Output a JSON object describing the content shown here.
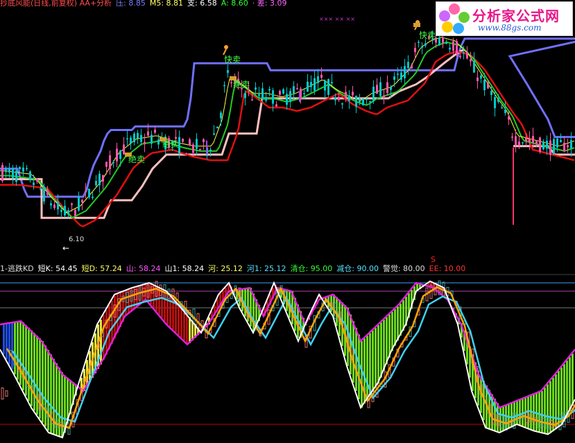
{
  "header": {
    "items": [
      {
        "text": "抄底风能(日线,前复权) AA+分析",
        "color": "#ff4d4d"
      },
      {
        "text": "压: 8.85",
        "color": "#7b7bff"
      },
      {
        "text": "M5: 8.81",
        "color": "#ffff66"
      },
      {
        "text": "支: 6.58",
        "color": "#ffffff"
      },
      {
        "text": "A: 8.60",
        "color": "#33ff33"
      },
      {
        "text": "· 差: 3.09",
        "color": "#ff66ff"
      }
    ]
  },
  "sub_header": {
    "items": [
      {
        "text": "1-逃跌KD",
        "color": "#dddddd"
      },
      {
        "text": "短K: 54.45",
        "color": "#ffffff"
      },
      {
        "text": "短D: 57.24",
        "color": "#ffff66"
      },
      {
        "text": "山: 58.24",
        "color": "#ff55ff"
      },
      {
        "text": "山1: 58.24",
        "color": "#ffffff"
      },
      {
        "text": "河: 25.12",
        "color": "#ffff66"
      },
      {
        "text": "河1: 25.12",
        "color": "#55e0ff"
      },
      {
        "text": "清仓: 95.00",
        "color": "#33ff33"
      },
      {
        "text": "减仓: 90.00",
        "color": "#55e0ff"
      },
      {
        "text": "警觉: 80.00",
        "color": "#dddddd"
      },
      {
        "text": "EE: 10.00",
        "color": "#ff3333"
      }
    ]
  },
  "logo": {
    "main": "分析家公式网",
    "url": "www.88gs.com"
  },
  "annotations": {
    "sell_fast": "快卖",
    "sell_must": "绝卖",
    "price_low": "6.10",
    "s_mark": "S",
    "arrow": "←",
    "xmark": "××× ×× ××"
  },
  "colors": {
    "up": "#ff55aa",
    "down": "#00c8c8",
    "pressure": "#7070ff",
    "support": "#ffc0c0",
    "ma_red": "#e01010",
    "ma_green": "#22cc22",
    "ma_yellow": "#ffff44",
    "kd_white": "#ffffff",
    "kd_magenta": "#e020e0",
    "kd_orange": "#ffa500",
    "kd_cyan": "#40d0f0",
    "grid_red": "#cc0000",
    "line95": "#40a0ff",
    "line90": "#b040b0",
    "text_green": "#44ff44"
  },
  "chart_data": [
    {
      "type": "candlestick",
      "title": "抄底风能(日线,前复权) AA+分析",
      "ylim": [
        5.7,
        9.4
      ],
      "series": [
        {
          "name": "压",
          "values": [
            7.0,
            7.0,
            7.0,
            7.0,
            7.0,
            7.0,
            6.85,
            6.7,
            6.6,
            6.6,
            6.6,
            6.6,
            6.6,
            6.6,
            6.6,
            6.6,
            6.6,
            6.6,
            6.6,
            6.6,
            6.6,
            6.6,
            6.6,
            6.6,
            6.6,
            6.7,
            6.9,
            7.05,
            7.15,
            7.25,
            7.4,
            7.5,
            7.55,
            7.55,
            7.55,
            7.55,
            7.55,
            7.55,
            7.55,
            7.6,
            7.6,
            7.6,
            7.6,
            7.6,
            7.6,
            7.6,
            7.6,
            7.6,
            7.6,
            7.6,
            7.6,
            7.6,
            7.6,
            7.6,
            7.7,
            8.0,
            8.5,
            8.5,
            8.5,
            8.5,
            8.5,
            8.5,
            8.5,
            8.5,
            8.5,
            8.5,
            8.5,
            8.5,
            8.5,
            8.5,
            8.5,
            8.5,
            8.5,
            8.5,
            8.5,
            8.5,
            8.5,
            8.5,
            8.4,
            8.4,
            8.4,
            8.4,
            8.4,
            8.4,
            8.4,
            8.4,
            8.4,
            8.4,
            8.4,
            8.4,
            8.4,
            8.4,
            8.4,
            8.4,
            8.4,
            8.4,
            8.4,
            8.4,
            8.4,
            8.4,
            8.4,
            8.4,
            8.4,
            8.4,
            8.4,
            8.4,
            8.4,
            8.4,
            8.4,
            8.4,
            8.4,
            8.4,
            8.4,
            8.4,
            8.4,
            8.4,
            8.4,
            8.4,
            8.4,
            8.4,
            8.4,
            8.4,
            8.4,
            8.4,
            8.4,
            8.4,
            8.4,
            8.4,
            8.4,
            8.4,
            8.4,
            8.4,
            8.6,
            8.75,
            8.85,
            8.85,
            8.85,
            8.85,
            8.85,
            8.85,
            8.85,
            8.85,
            8.85,
            8.85,
            8.85,
            8.85,
            8.85,
            8.85,
            8.85,
            8.85,
            8.85,
            8.85,
            8.85,
            8.85,
            8.85,
            8.85,
            8.85,
            8.85,
            8.85,
            8.85,
            8.85,
            8.85,
            8.85,
            8.85,
            8.85,
            8.85,
            8.85,
            8.85,
            8.85,
            8.85,
            8.85
          ]
        },
        {
          "name": "支",
          "values": [
            6.58
          ]
        }
      ]
    },
    {
      "type": "line",
      "title": "1-逃跌KD",
      "ylim": [
        0,
        100
      ],
      "series": [
        {
          "name": "清仓",
          "values": [
            95
          ]
        },
        {
          "name": "减仓",
          "values": [
            90
          ]
        },
        {
          "name": "警觉",
          "values": [
            80
          ]
        },
        {
          "name": "EE",
          "values": [
            10
          ]
        },
        {
          "name": "短K",
          "values": [
            54.45
          ]
        },
        {
          "name": "短D",
          "values": [
            57.24
          ]
        },
        {
          "name": "山",
          "values": [
            58.24
          ]
        },
        {
          "name": "河",
          "values": [
            25.12
          ]
        }
      ]
    }
  ]
}
